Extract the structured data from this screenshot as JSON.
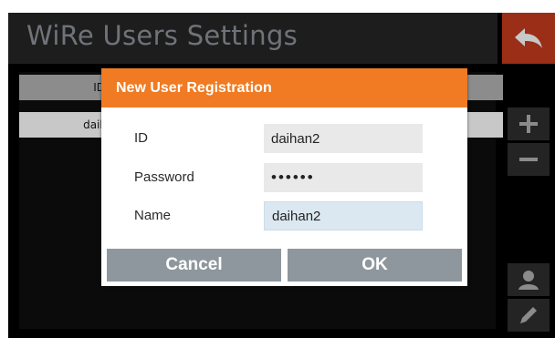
{
  "header": {
    "title": "WiRe Users Settings"
  },
  "table": {
    "columns": [
      "ID",
      ""
    ],
    "rows": [
      {
        "id": "daih",
        "other": ""
      }
    ]
  },
  "side_buttons": [
    "back-icon",
    "plus-icon",
    "minus-icon",
    "user-icon",
    "pencil-icon"
  ],
  "dialog": {
    "title": "New User Registration",
    "fields": [
      {
        "label": "ID",
        "value": "daihan2"
      },
      {
        "label": "Password",
        "value": "••••••"
      },
      {
        "label": "Name",
        "value": "daihan2"
      }
    ],
    "cancel_label": "Cancel",
    "ok_label": "OK"
  },
  "colors": {
    "accent": "#f07b23",
    "back_button": "#9a2e16",
    "dialog_button": "#8e979d"
  }
}
